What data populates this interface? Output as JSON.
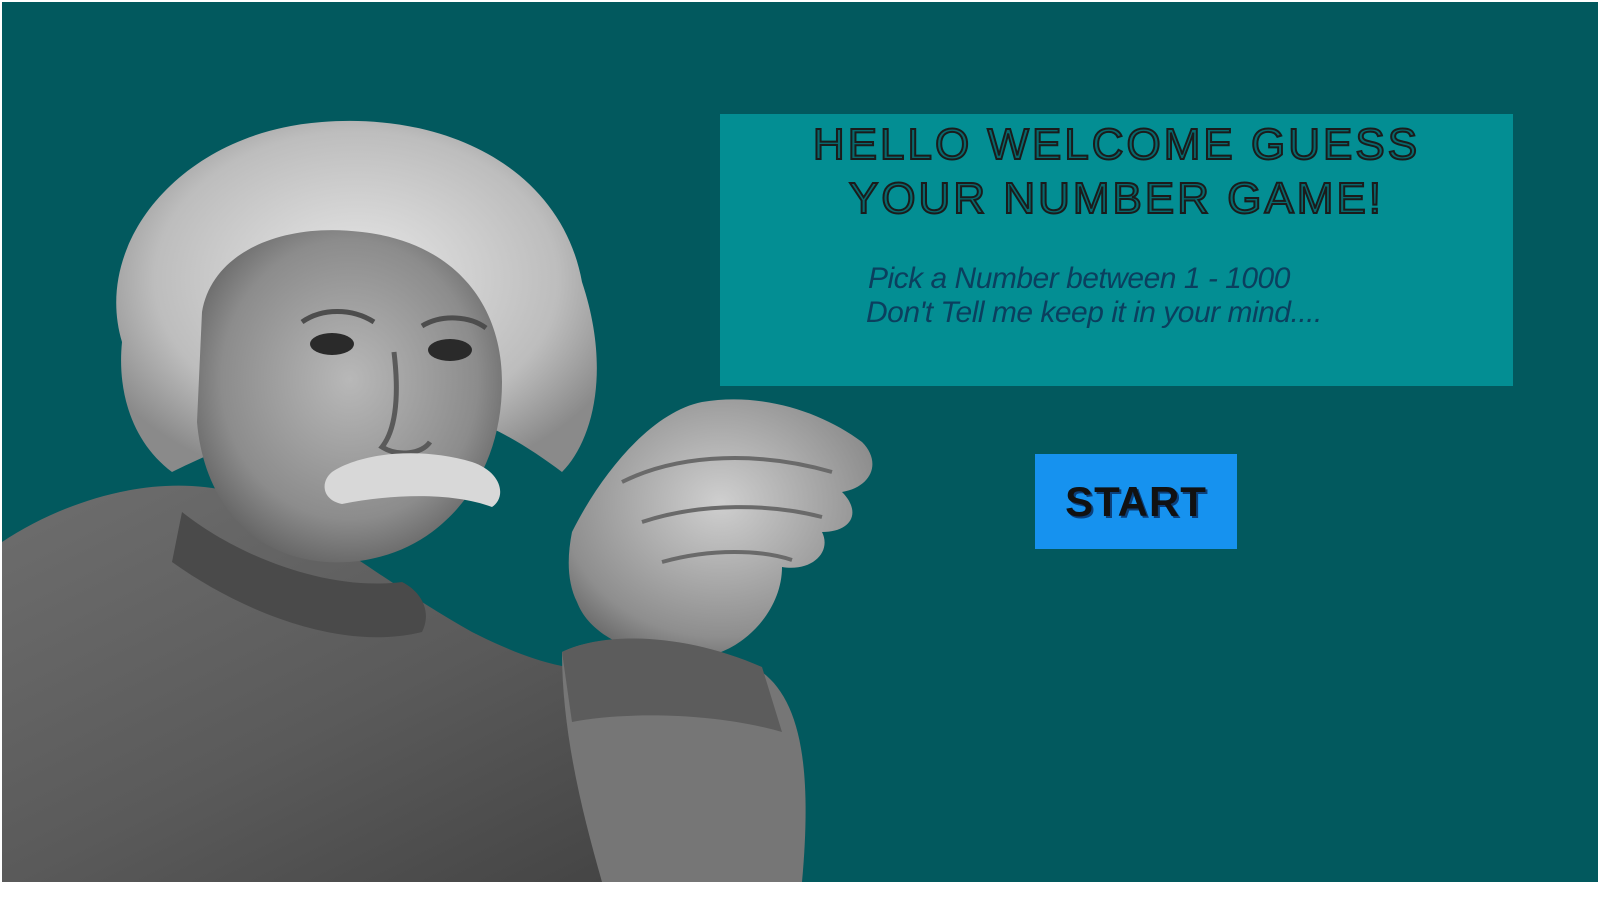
{
  "screen": {
    "background_color": "#02595e",
    "panel_color": "#038e93",
    "button_color": "#1692ef"
  },
  "title": {
    "line1": "HELLO WELCOME GUESS",
    "line2": "YOUR NUMBER GAME!"
  },
  "instructions": {
    "line1": "Pick a Number between 1  - 1000",
    "line2": "Don't Tell me keep it in your mind...."
  },
  "start_button": {
    "label": "START"
  },
  "portrait": {
    "icon": "thinking-scientist-portrait"
  }
}
